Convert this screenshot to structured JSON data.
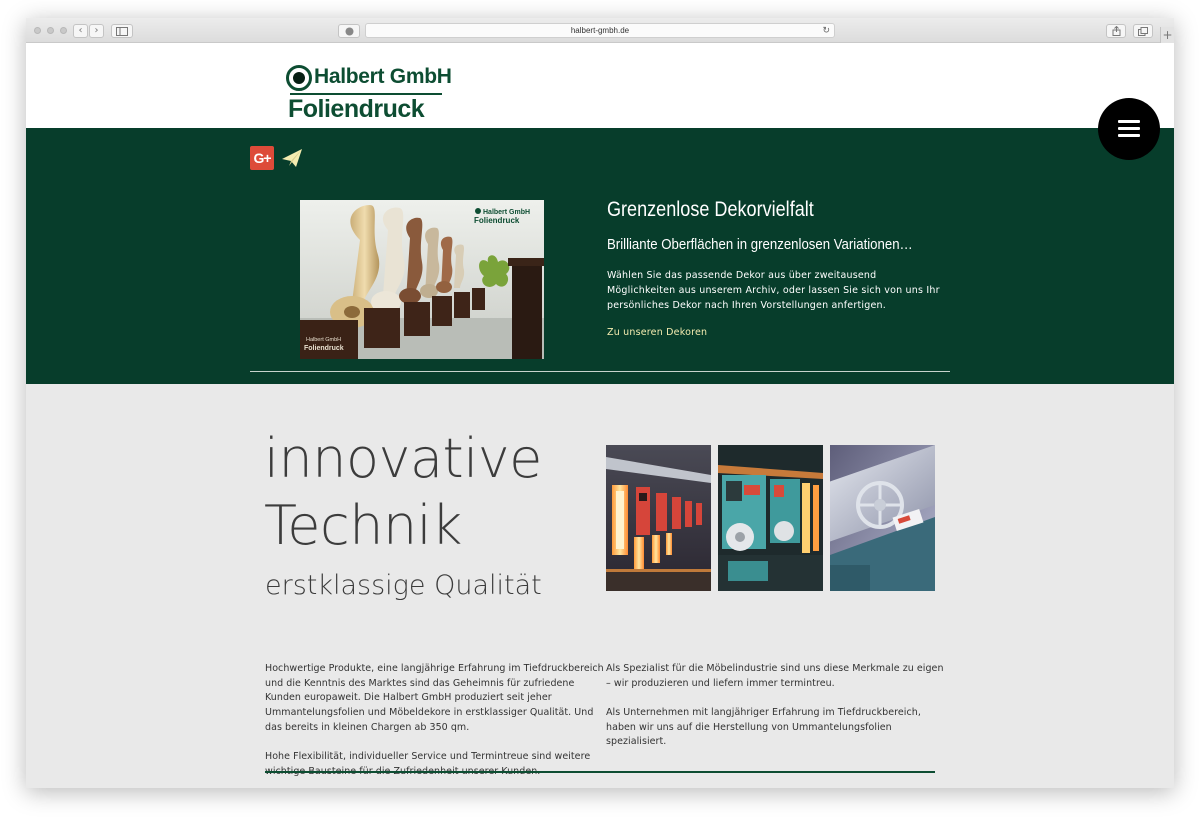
{
  "browser": {
    "url": "halbert-gmbh.de",
    "back_glyph": "‹",
    "forward_glyph": "›",
    "reload_glyph": "↻",
    "newtab_glyph": "+"
  },
  "logo": {
    "top_text": "Halbert GmbH",
    "bottom_text": "Foliendruck"
  },
  "social": {
    "gplus_label": "G+"
  },
  "hero": {
    "title": "Grenzenlose Dekorvielfalt",
    "subtitle": "Brilliante Oberflächen in grenzenlosen Variationen…",
    "body": "Wählen Sie das passende Dekor aus über zweitausend Möglichkeiten aus unserem Archiv, oder lassen Sie sich von uns Ihr persönliches Dekor nach Ihren Vorstellungen anfertigen.",
    "link": "Zu unseren Dekoren",
    "photo_logo_top": "Halbert GmbH",
    "photo_logo_bottom": "Foliendruck",
    "photo_label_top": "Halbert GmbH",
    "photo_label_bottom": "Foliendruck"
  },
  "intro": {
    "headline_1": "innovative",
    "headline_2": "Technik",
    "tagline": "erstklassige Qualität"
  },
  "text": {
    "left_1": "Hochwertige Produkte, eine langjährige Erfahrung im Tiefdruckbereich und die Kenntnis des Marktes sind das Geheimnis für zufriedene Kunden europaweit. Die Halbert GmbH produziert seit jeher Ummantelungsfolien und Möbeldekore in erstklassiger Qualität. Und das bereits in kleinen Chargen ab 350 qm.",
    "left_2": "Hohe Flexibilität, individueller Service und Termintreue sind weitere wichtige Bausteine für die Zufriedenheit unserer Kunden.",
    "right_1": "Als Spezialist für die Möbelindustrie sind uns diese Merkmale zu eigen – wir produzieren und liefern immer termintreu.",
    "right_2": "Als Unternehmen mit langjähriger Erfahrung im Tiefdruckbereich, haben wir uns auf die Herstellung von Ummantelungsfolien spezialisiert."
  },
  "colors": {
    "brand_green": "#073d2b",
    "logo_green": "#0d4d32",
    "link_yellow": "#f4ecb0",
    "gplus_red": "#dd4b39",
    "content_bg": "#e9e9e9"
  },
  "icons": [
    "gplus-icon",
    "send-icon",
    "hamburger-icon",
    "reload-icon",
    "share-icon",
    "tabs-icon",
    "sidebar-icon"
  ]
}
